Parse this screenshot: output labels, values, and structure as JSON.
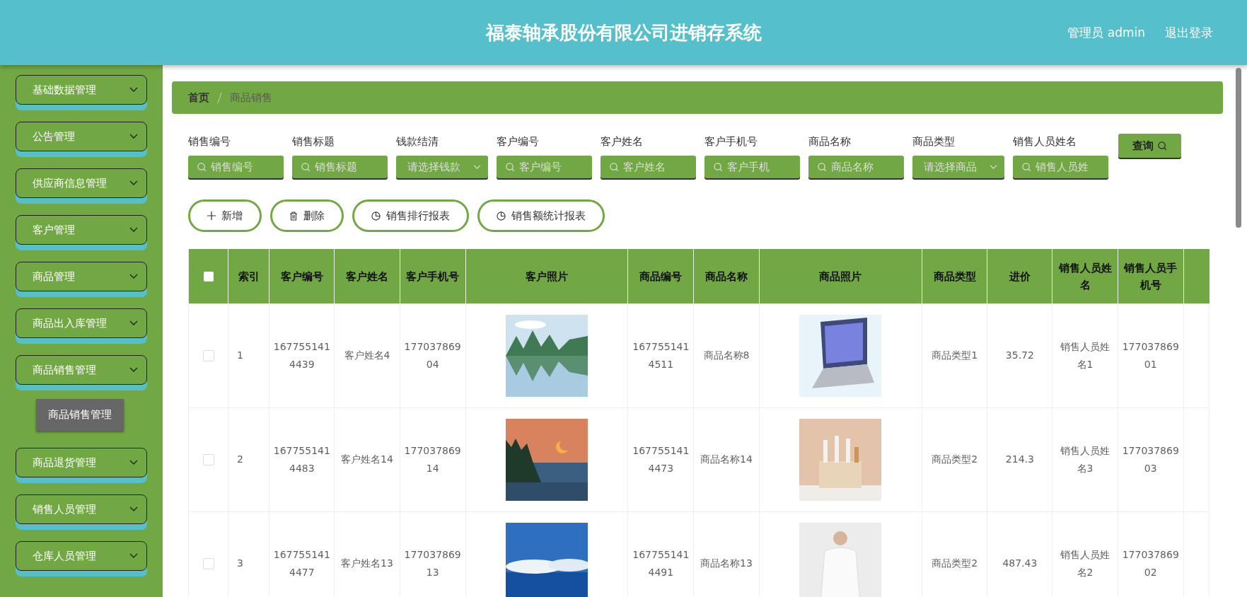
{
  "header": {
    "title": "福泰轴承股份有限公司进销存系统",
    "user": "管理员 admin",
    "logout": "退出登录"
  },
  "sidebar": {
    "items": [
      {
        "label": "基础数据管理"
      },
      {
        "label": "公告管理"
      },
      {
        "label": "供应商信息管理"
      },
      {
        "label": "客户管理"
      },
      {
        "label": "商品管理"
      },
      {
        "label": "商品出入库管理"
      },
      {
        "label": "商品销售管理",
        "children": [
          {
            "label": "商品销售管理"
          }
        ]
      },
      {
        "label": "商品退货管理"
      },
      {
        "label": "销售人员管理"
      },
      {
        "label": "仓库人员管理"
      }
    ]
  },
  "breadcrumb": [
    "首页",
    "商品销售"
  ],
  "search": {
    "fields": [
      {
        "label": "销售编号",
        "kind": "input",
        "placeholder": "销售编号"
      },
      {
        "label": "销售标题",
        "kind": "input",
        "placeholder": "销售标题"
      },
      {
        "label": "钱款结清",
        "kind": "select",
        "placeholder": "请选择钱款"
      },
      {
        "label": "客户编号",
        "kind": "input",
        "placeholder": "客户编号"
      },
      {
        "label": "客户姓名",
        "kind": "input",
        "placeholder": "客户姓名"
      },
      {
        "label": "客户手机号",
        "kind": "input",
        "placeholder": "客户手机"
      },
      {
        "label": "商品名称",
        "kind": "input",
        "placeholder": "商品名称"
      },
      {
        "label": "商品类型",
        "kind": "select",
        "placeholder": "请选择商品"
      },
      {
        "label": "销售人员姓名",
        "kind": "input",
        "placeholder": "销售人员姓"
      }
    ],
    "button": "查询"
  },
  "actions": [
    {
      "label": "新增",
      "kind": "add"
    },
    {
      "label": "删除",
      "kind": "delete"
    },
    {
      "label": "销售排行报表",
      "kind": "chart"
    },
    {
      "label": "销售额统计报表",
      "kind": "chart"
    }
  ],
  "table": {
    "select_all": {
      "checked": false
    },
    "columns": [
      "索引",
      "客户编号",
      "客户姓名",
      "客户手机号",
      "客户照片",
      "商品编号",
      "商品名称",
      "商品照片",
      "商品类型",
      "进价",
      "销售人员姓名",
      "销售人员手机号"
    ],
    "rows": [
      {
        "checked": false,
        "cells": [
          "1",
          "1677551414439",
          "客户姓名4",
          "17703786904",
          {
            "kind": "picture"
          },
          "1677551414511",
          "商品名称8",
          {
            "kind": "picture"
          },
          "商品类型1",
          "35.72",
          "销售人员姓名1",
          "17703786901"
        ]
      },
      {
        "checked": false,
        "cells": [
          "2",
          "1677551414483",
          "客户姓名14",
          "17703786914",
          {
            "kind": "picture"
          },
          "1677551414473",
          "商品名称14",
          {
            "kind": "picture"
          },
          "商品类型2",
          "214.3",
          "销售人员姓名3",
          "17703786903"
        ]
      },
      {
        "checked": false,
        "cells": [
          "3",
          "1677551414477",
          "客户姓名13",
          "17703786913",
          {
            "kind": "picture"
          },
          "1677551414491",
          "商品名称13",
          {
            "kind": "picture"
          },
          "商品类型2",
          "487.43",
          "销售人员姓名2",
          "17703786902"
        ]
      }
    ]
  }
}
